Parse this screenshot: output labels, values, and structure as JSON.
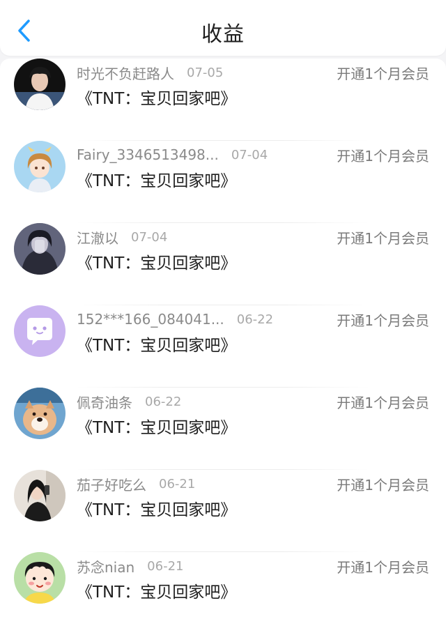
{
  "header": {
    "title": "收益",
    "back_icon": "chevron-left-icon",
    "accent": "#1e9bff"
  },
  "records": [
    {
      "nickname": "时光不负赶路人",
      "date": "07-05",
      "work": "《TNT：宝贝回家吧》",
      "status": "开通1个月会员",
      "avatar": "user-avatar-boy"
    },
    {
      "nickname": "Fairy_3346513498...",
      "date": "07-04",
      "work": "《TNT：宝贝回家吧》",
      "status": "开通1个月会员",
      "avatar": "user-avatar-cartoon-girl"
    },
    {
      "nickname": "江澈以",
      "date": "07-04",
      "work": "《TNT：宝贝回家吧》",
      "status": "开通1个月会员",
      "avatar": "user-avatar-dark-photo"
    },
    {
      "nickname": "152***166_084041...",
      "date": "06-22",
      "work": "《TNT：宝贝回家吧》",
      "status": "开通1个月会员",
      "avatar": "default-chat-avatar"
    },
    {
      "nickname": "佩奇油条",
      "date": "06-22",
      "work": "《TNT：宝贝回家吧》",
      "status": "开通1个月会员",
      "avatar": "user-avatar-dog"
    },
    {
      "nickname": "茄子好吃么",
      "date": "06-21",
      "work": "《TNT：宝贝回家吧》",
      "status": "开通1个月会员",
      "avatar": "user-avatar-woman"
    },
    {
      "nickname": "苏念nian",
      "date": "06-21",
      "work": "《TNT：宝贝回家吧》",
      "status": "开通1个月会员",
      "avatar": "user-avatar-cartoon-kid"
    }
  ]
}
